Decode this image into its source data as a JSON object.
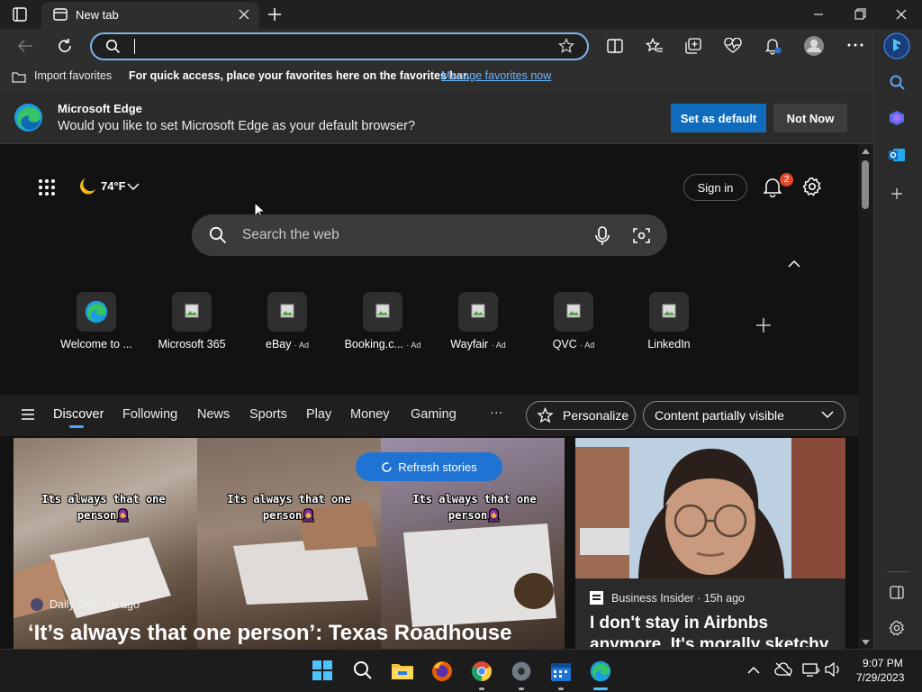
{
  "tab": {
    "title": "New tab"
  },
  "favorites_bar": {
    "import_label": "Import favorites",
    "message": "For quick access, place your favorites here on the favorites bar.",
    "manage_link": "Manage favorites now"
  },
  "infobar": {
    "title": "Microsoft Edge",
    "message": "Would you like to set Microsoft Edge as your default browser?",
    "set_default_label": "Set as default",
    "not_now_label": "Not Now"
  },
  "weather": {
    "temperature": "74°F"
  },
  "header": {
    "sign_in_label": "Sign in",
    "notification_count": "2"
  },
  "search": {
    "placeholder": "Search the web"
  },
  "quick_links": [
    {
      "label": "Welcome to ...",
      "ad": ""
    },
    {
      "label": "Microsoft 365",
      "ad": ""
    },
    {
      "label": "eBay",
      "ad": "· Ad"
    },
    {
      "label": "Booking.c...",
      "ad": "· Ad"
    },
    {
      "label": "Wayfair",
      "ad": "· Ad"
    },
    {
      "label": "QVC",
      "ad": "· Ad"
    },
    {
      "label": "LinkedIn",
      "ad": ""
    }
  ],
  "nav": {
    "items": [
      "Discover",
      "Following",
      "News",
      "Sports",
      "Play",
      "Money",
      "Gaming"
    ],
    "more": "···",
    "personalize_label": "Personalize",
    "content_visibility": "Content partially visible"
  },
  "refresh_label": "Refresh stories",
  "stories": [
    {
      "source": "Daily Dot · 7h ago",
      "title": "‘It’s always that one person’: Texas Roadhouse",
      "caption_line1": "Its always that one",
      "caption_line2": "person🧕"
    },
    {
      "source": "Business Insider · 15h ago",
      "title": "I don't stay in Airbnbs anymore. It's morally sketchy"
    }
  ],
  "taskbar": {
    "time": "9:07 PM",
    "date": "7/29/2023"
  },
  "colors": {
    "accent": "#0f6cbd",
    "link": "#6cb4ff",
    "refresh": "#1f74d3",
    "badge": "#e0492c"
  }
}
